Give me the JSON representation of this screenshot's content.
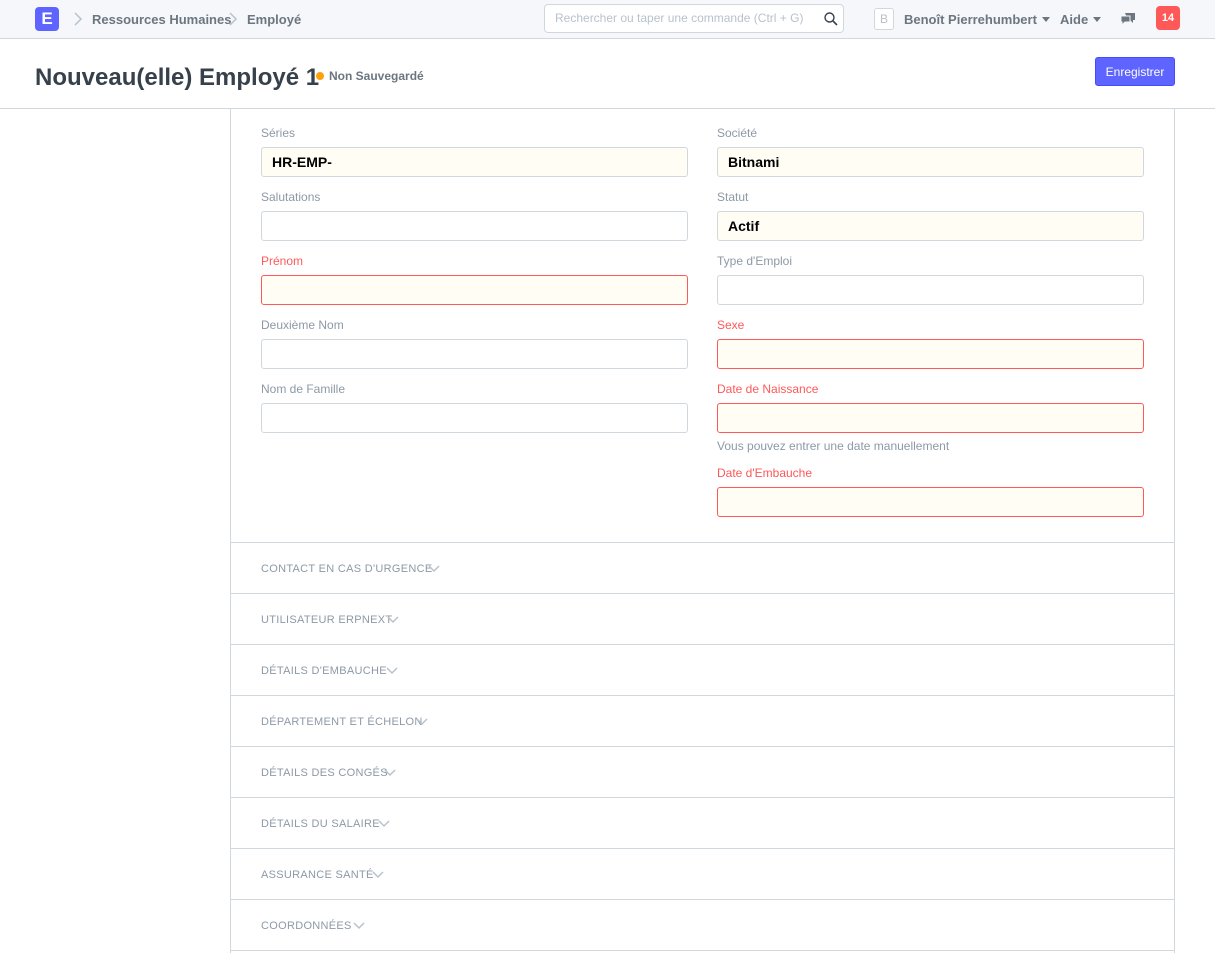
{
  "navbar": {
    "logo": "E",
    "breadcrumbs": [
      "Ressources Humaines",
      "Employé"
    ],
    "search_placeholder": "Rechercher ou taper une commande (Ctrl + G)",
    "avatar_letter": "B",
    "user_name": "Benoît Pierrehumbert",
    "help_label": "Aide",
    "notification_count": "14"
  },
  "page": {
    "title": "Nouveau(elle) Employé 1",
    "status": "Non Sauvegardé",
    "save_label": "Enregistrer"
  },
  "form": {
    "left": [
      {
        "label": "Séries",
        "value": "HR-EMP-",
        "required": false
      },
      {
        "label": "Salutations",
        "value": "",
        "required": false
      },
      {
        "label": "Prénom",
        "value": "",
        "required": true
      },
      {
        "label": "Deuxième Nom",
        "value": "",
        "required": false
      },
      {
        "label": "Nom de Famille",
        "value": "",
        "required": false
      }
    ],
    "right": [
      {
        "label": "Société",
        "value": "Bitnami",
        "required": false
      },
      {
        "label": "Statut",
        "value": "Actif",
        "required": false
      },
      {
        "label": "Type d'Emploi",
        "value": "",
        "required": false
      },
      {
        "label": "Sexe",
        "value": "",
        "required": true
      },
      {
        "label": "Date de Naissance",
        "value": "",
        "required": true,
        "help": "Vous pouvez entrer une date manuellement"
      },
      {
        "label": "Date d'Embauche",
        "value": "",
        "required": true
      }
    ]
  },
  "sections": [
    "CONTACT EN CAS D'URGENCE",
    "UTILISATEUR ERPNEXT",
    "DÉTAILS D'EMBAUCHE",
    "DÉPARTEMENT ET ÉCHELON",
    "DÉTAILS DES CONGÉS",
    "DÉTAILS DU SALAIRE",
    "ASSURANCE SANTÉ",
    "COORDONNÉES"
  ],
  "colors": {
    "accent": "#5e64ff",
    "required": "#ff5858",
    "unsaved": "#ffa00a"
  }
}
